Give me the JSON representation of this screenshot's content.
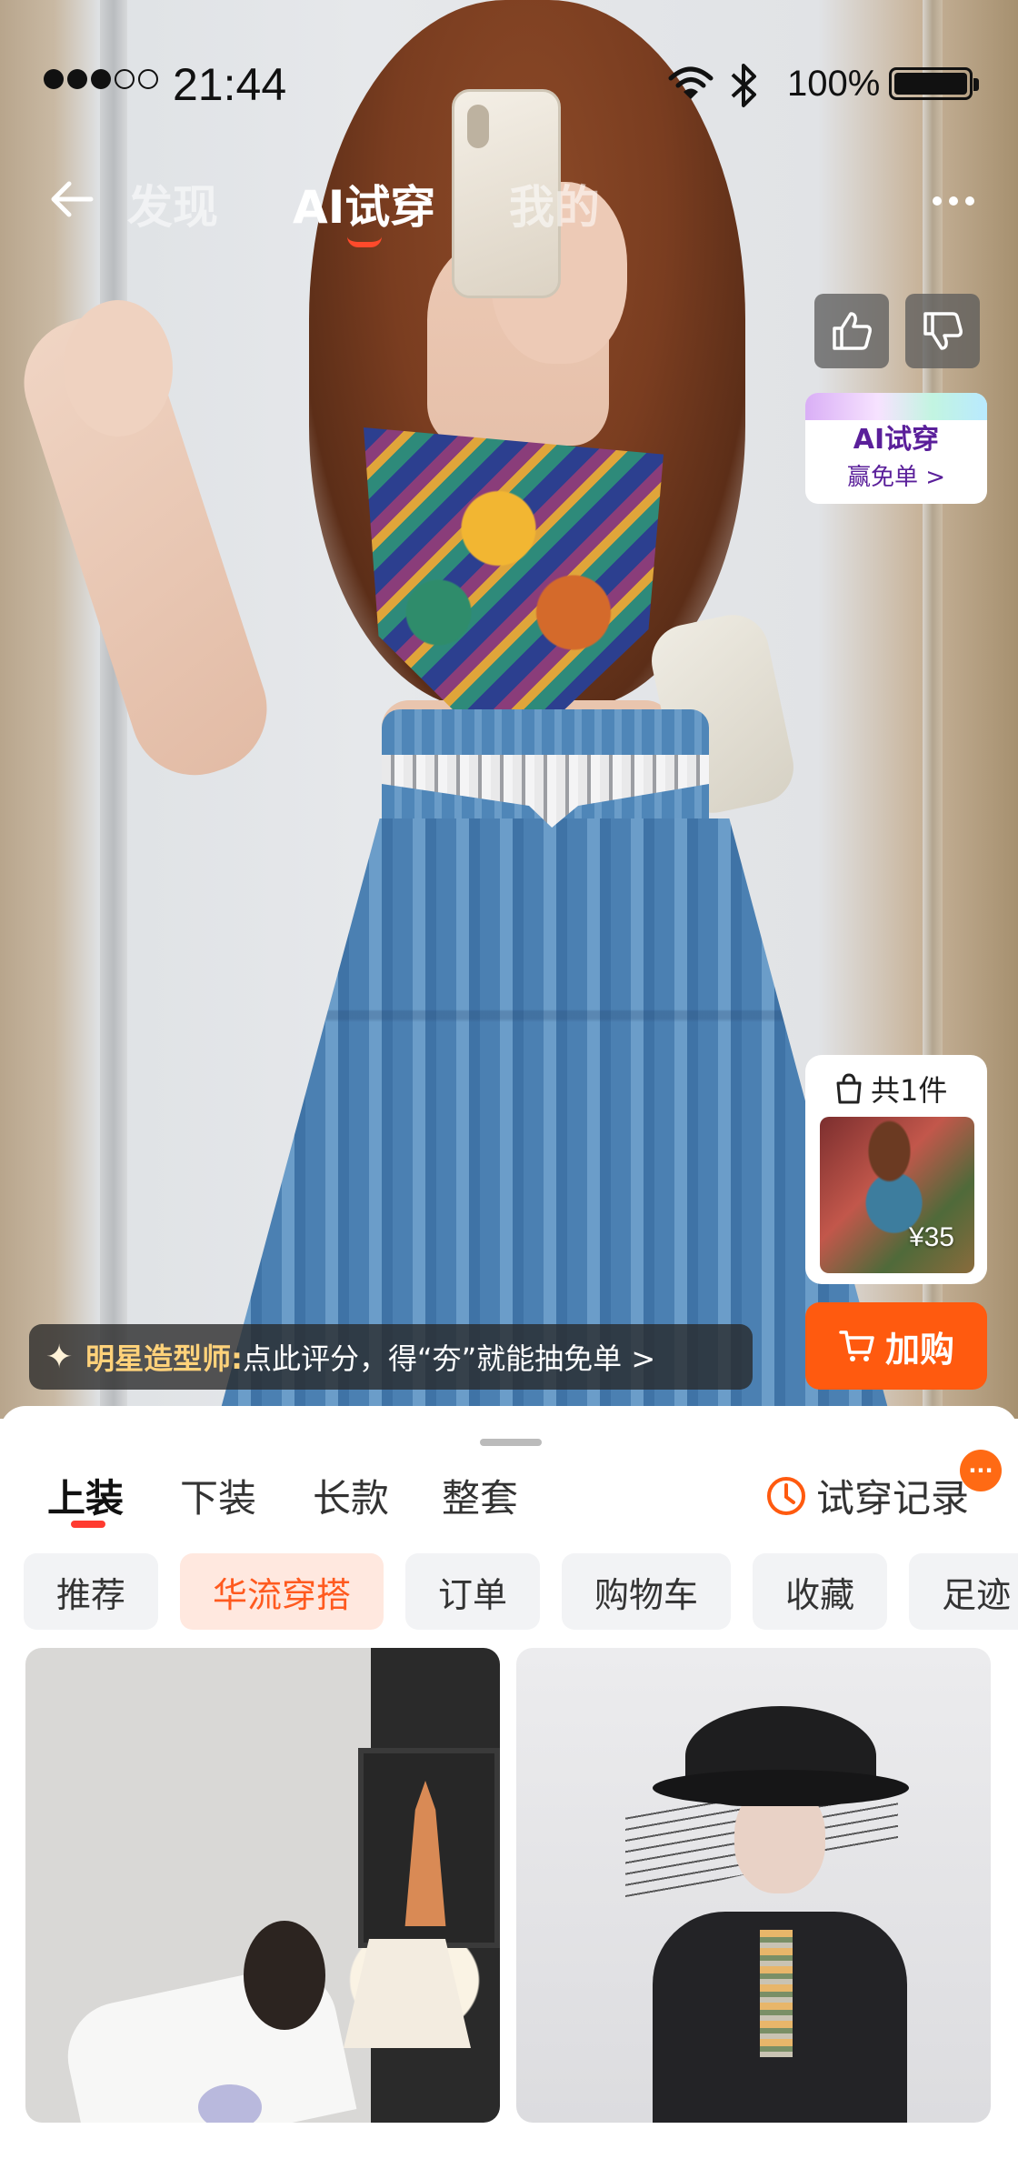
{
  "status_bar": {
    "time": "21:44",
    "battery": "100%",
    "signal_bars_filled": 3,
    "signal_bars_total": 5
  },
  "nav": {
    "tabs": [
      {
        "label": "发现",
        "active": false
      },
      {
        "label": "AI试穿",
        "active": true
      },
      {
        "label": "我的",
        "active": false
      }
    ]
  },
  "feedback": {
    "like_icon": "thumbs-up-icon",
    "dislike_icon": "thumbs-down-icon"
  },
  "promo": {
    "title": "AI试穿",
    "subtitle": "赢免单 >"
  },
  "bundle": {
    "count_label": "共1件",
    "price": "¥35"
  },
  "cart_button": {
    "label": "加购"
  },
  "stylist_banner": {
    "strong": "明星造型师:",
    "rest": " 点此评分，得“夯”就能抽免单 >"
  },
  "categories": {
    "items": [
      {
        "label": "上装",
        "active": true
      },
      {
        "label": "下装",
        "active": false
      },
      {
        "label": "长款",
        "active": false
      },
      {
        "label": "整套",
        "active": false
      }
    ],
    "history_label": "试穿记录",
    "notification_badge": "···"
  },
  "chips": [
    {
      "label": "推荐",
      "active": false
    },
    {
      "label": "华流穿搭",
      "active": true
    },
    {
      "label": "订单",
      "active": false
    },
    {
      "label": "购物车",
      "active": false
    },
    {
      "label": "收藏",
      "active": false
    },
    {
      "label": "足迹",
      "active": false
    }
  ],
  "colors": {
    "accent": "#ff5a0f",
    "tab_underline": "#ff3b30",
    "promo_text": "#5a1f9a",
    "chip_active_bg": "#ffe8df"
  }
}
